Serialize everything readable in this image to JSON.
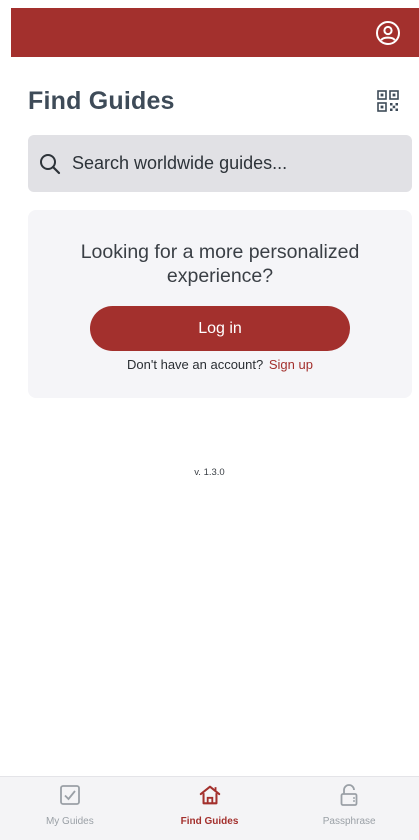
{
  "header": {
    "profile_icon": "user-circle-icon"
  },
  "page": {
    "title": "Find Guides",
    "qr_icon": "qr-code-icon"
  },
  "search": {
    "placeholder": "Search worldwide guides...",
    "icon": "search-icon"
  },
  "card": {
    "title": "Looking for a more personalized experience?",
    "login_label": "Log in",
    "no_account_text": "Don't have an account?",
    "signup_label": "Sign up"
  },
  "version": "v. 1.3.0",
  "tabbar": {
    "tabs": [
      {
        "label": "My Guides",
        "icon": "checkbox-icon",
        "active": false
      },
      {
        "label": "Find Guides",
        "icon": "home-icon",
        "active": true
      },
      {
        "label": "Passphrase",
        "icon": "lock-icon",
        "active": false
      }
    ]
  },
  "colors": {
    "brand": "#a3302d",
    "title": "#3e4b58",
    "search_bg": "#e1e1e5",
    "card_bg": "#f5f5f8",
    "inactive_tab": "#9aa0a6"
  }
}
